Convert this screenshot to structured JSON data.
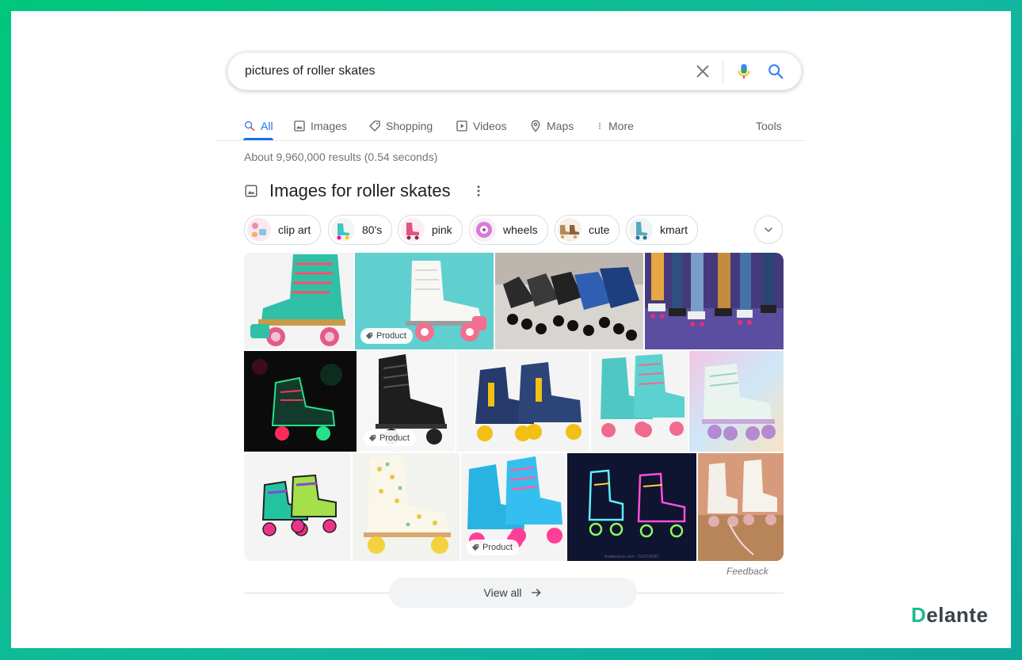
{
  "search": {
    "query": "pictures of roller skates"
  },
  "tabs": [
    {
      "label": "All",
      "icon": "search-icon"
    },
    {
      "label": "Images",
      "icon": "image-icon"
    },
    {
      "label": "Shopping",
      "icon": "tag-icon"
    },
    {
      "label": "Videos",
      "icon": "play-icon"
    },
    {
      "label": "Maps",
      "icon": "pin-icon"
    },
    {
      "label": "More",
      "icon": "dots-vertical-icon"
    }
  ],
  "tools_label": "Tools",
  "stats": "About 9,960,000 results (0.54 seconds)",
  "images_section": {
    "title": "Images for roller skates",
    "chips": [
      "clip art",
      "80's",
      "pink",
      "wheels",
      "cute",
      "kmart"
    ],
    "badge_label": "Product",
    "feedback": "Feedback",
    "view_all": "View all",
    "watermark": "shutterstock.com · 2119741667"
  },
  "brand": {
    "first": "D",
    "rest": "elante"
  },
  "colors": {
    "accent": "#1a73e8",
    "frame": "#00c77a",
    "brand": "#19b98f"
  }
}
